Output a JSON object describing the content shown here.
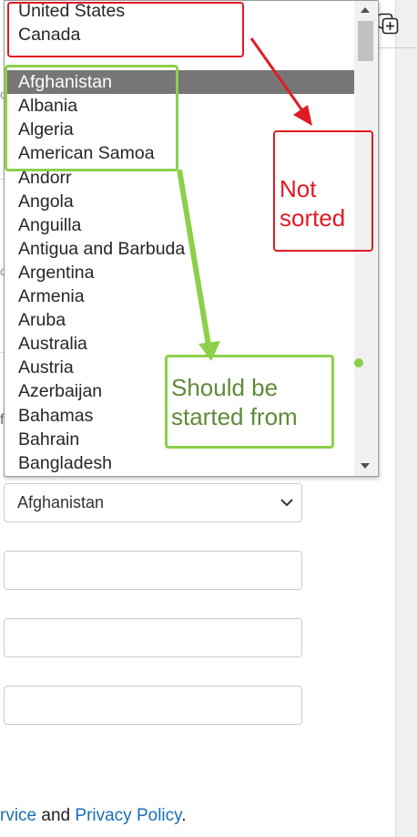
{
  "dropdown": {
    "priority_items": [
      "United States",
      "Canada"
    ],
    "items": [
      "Afghanistan",
      "Albania",
      "Algeria",
      "American Samoa",
      "Andorr",
      "Angola",
      "Anguilla",
      "Antigua and Barbuda",
      "Argentina",
      "Armenia",
      "Aruba",
      "Australia",
      "Austria",
      "Azerbaijan",
      "Bahamas",
      "Bahrain",
      "Bangladesh"
    ],
    "selected": "Afghanistan"
  },
  "form": {
    "country_value": "Afghanistan",
    "terms": {
      "prefix": "rvice",
      "middle": " and ",
      "privacy": "Privacy Policy",
      "suffix": "."
    }
  },
  "annotations": {
    "not_sorted_line1": "Not",
    "not_sorted_line2": "sorted",
    "should_be_line1": "Should be",
    "should_be_line2": "started from",
    "colors": {
      "red": "#e01b24",
      "green": "#8cd04a",
      "green_text": "#5f8a36"
    }
  },
  "icons": {
    "add": "add-window-icon",
    "chevron": "chevron-down-icon"
  }
}
